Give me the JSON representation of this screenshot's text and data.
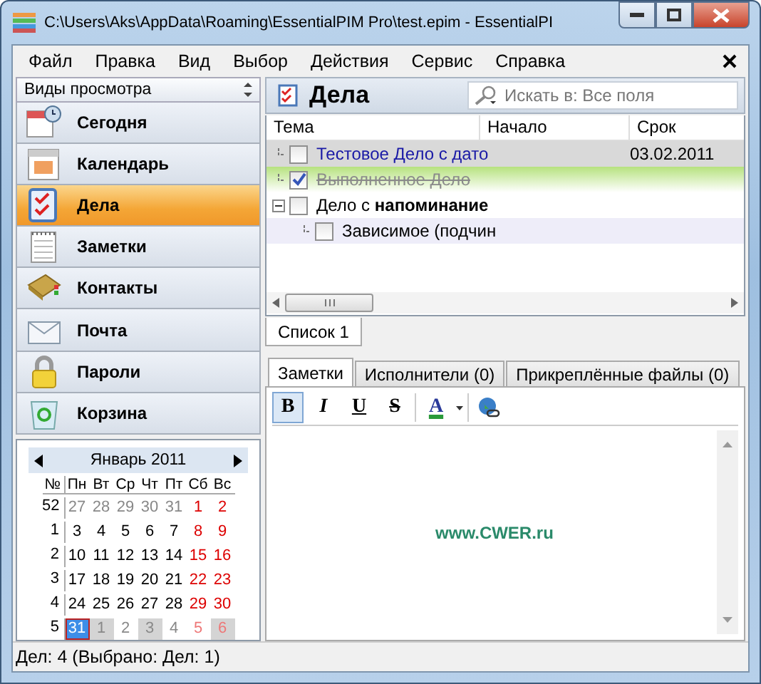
{
  "window": {
    "title": "C:\\Users\\Aks\\AppData\\Roaming\\EssentialPIM Pro\\test.epim - EssentialPI"
  },
  "menu": [
    {
      "label": "Файл"
    },
    {
      "label": "Правка"
    },
    {
      "label": "Вид"
    },
    {
      "label": "Выбор"
    },
    {
      "label": "Действия"
    },
    {
      "label": "Сервис"
    },
    {
      "label": "Справка"
    }
  ],
  "sidebar": {
    "header": "Виды просмотра",
    "items": [
      {
        "label": "Сегодня",
        "kind": "today",
        "selected": false
      },
      {
        "label": "Календарь",
        "kind": "calendar",
        "selected": false
      },
      {
        "label": "Дела",
        "kind": "tasks",
        "selected": true
      },
      {
        "label": "Заметки",
        "kind": "notes",
        "selected": false
      },
      {
        "label": "Контакты",
        "kind": "contacts",
        "selected": false
      },
      {
        "label": "Почта",
        "kind": "mail",
        "selected": false
      },
      {
        "label": "Пароли",
        "kind": "passwords",
        "selected": false
      },
      {
        "label": "Корзина",
        "kind": "trash",
        "selected": false
      }
    ]
  },
  "calendar": {
    "month": "Январь  2011",
    "headers": [
      "№",
      "Пн",
      "Вт",
      "Ср",
      "Чт",
      "Пт",
      "Сб",
      "Вс"
    ],
    "weeks": [
      {
        "num": "52",
        "days": [
          {
            "text": "27",
            "kind": "other",
            "marked": false
          },
          {
            "text": "28",
            "kind": "other",
            "marked": false
          },
          {
            "text": "29",
            "kind": "other",
            "marked": false
          },
          {
            "text": "30",
            "kind": "other",
            "marked": false
          },
          {
            "text": "31",
            "kind": "other",
            "marked": false
          },
          {
            "text": "1",
            "kind": "weekend",
            "marked": false
          },
          {
            "text": "2",
            "kind": "weekend",
            "marked": false
          }
        ]
      },
      {
        "num": "1",
        "days": [
          {
            "text": "3",
            "kind": "normal",
            "marked": false
          },
          {
            "text": "4",
            "kind": "normal",
            "marked": false
          },
          {
            "text": "5",
            "kind": "normal",
            "marked": false
          },
          {
            "text": "6",
            "kind": "normal",
            "marked": false
          },
          {
            "text": "7",
            "kind": "normal",
            "marked": false
          },
          {
            "text": "8",
            "kind": "weekend",
            "marked": false
          },
          {
            "text": "9",
            "kind": "weekend",
            "marked": false
          }
        ]
      },
      {
        "num": "2",
        "days": [
          {
            "text": "10",
            "kind": "normal",
            "marked": false
          },
          {
            "text": "11",
            "kind": "normal",
            "marked": false
          },
          {
            "text": "12",
            "kind": "normal",
            "marked": false
          },
          {
            "text": "13",
            "kind": "normal",
            "marked": false
          },
          {
            "text": "14",
            "kind": "normal",
            "marked": false
          },
          {
            "text": "15",
            "kind": "weekend",
            "marked": false
          },
          {
            "text": "16",
            "kind": "weekend",
            "marked": false
          }
        ]
      },
      {
        "num": "3",
        "days": [
          {
            "text": "17",
            "kind": "normal",
            "marked": false
          },
          {
            "text": "18",
            "kind": "normal",
            "marked": false
          },
          {
            "text": "19",
            "kind": "normal",
            "marked": false
          },
          {
            "text": "20",
            "kind": "normal",
            "marked": false
          },
          {
            "text": "21",
            "kind": "normal",
            "marked": false
          },
          {
            "text": "22",
            "kind": "weekend",
            "marked": false
          },
          {
            "text": "23",
            "kind": "weekend",
            "marked": false
          }
        ]
      },
      {
        "num": "4",
        "days": [
          {
            "text": "24",
            "kind": "normal",
            "marked": false
          },
          {
            "text": "25",
            "kind": "normal",
            "marked": false
          },
          {
            "text": "26",
            "kind": "normal",
            "marked": false
          },
          {
            "text": "27",
            "kind": "normal",
            "marked": false
          },
          {
            "text": "28",
            "kind": "normal",
            "marked": false
          },
          {
            "text": "29",
            "kind": "weekend",
            "marked": false
          },
          {
            "text": "30",
            "kind": "weekend",
            "marked": false
          }
        ]
      },
      {
        "num": "5",
        "days": [
          {
            "text": "31",
            "kind": "today",
            "marked": false
          },
          {
            "text": "1",
            "kind": "other",
            "marked": true
          },
          {
            "text": "2",
            "kind": "other",
            "marked": false
          },
          {
            "text": "3",
            "kind": "other",
            "marked": true
          },
          {
            "text": "4",
            "kind": "other",
            "marked": false
          },
          {
            "text": "5",
            "kind": "other-weekend",
            "marked": false
          },
          {
            "text": "6",
            "kind": "other-weekend",
            "marked": true
          }
        ]
      }
    ]
  },
  "tasks": {
    "title": "Дела",
    "search": {
      "placeholder": "Искать в: Все поля"
    },
    "columns": [
      "Тема",
      "Начало",
      "Срок"
    ],
    "rows": [
      {
        "subject": "Тестовое Дело с дато",
        "due": "03.02.2011",
        "checked": false,
        "selected": true,
        "color": "#1a1aa6"
      },
      {
        "subject": "Выполненное Дело",
        "checked": true,
        "selected": false,
        "color": "#8a8a8a"
      },
      {
        "subject": "Дело с **напоминание**",
        "checked": false,
        "selected": false,
        "color": "#000000",
        "expanded": true,
        "children": [
          {
            "subject": "Зависимое (подчин",
            "checked": false,
            "selected": false,
            "color": "#000000"
          }
        ]
      }
    ]
  },
  "list_tabs": [
    {
      "label": "Список 1",
      "selected": true
    }
  ],
  "detail_tabs": [
    {
      "label": "Заметки",
      "selected": true
    },
    {
      "label": "Исполнители (0)",
      "selected": false
    },
    {
      "label": "Прикреплённые файлы (0)",
      "selected": false
    }
  ],
  "format_toolbar": [
    {
      "kind": "bold",
      "label": "B",
      "on": true
    },
    {
      "kind": "italic",
      "label": "I",
      "on": false
    },
    {
      "kind": "underline",
      "label": "U",
      "on": false
    },
    {
      "kind": "strike",
      "label": "S",
      "on": false
    },
    {
      "kind": "color",
      "label": "A",
      "on": false
    },
    {
      "kind": "link",
      "on": false
    }
  ],
  "notes": {
    "text": "www.CWER.ru"
  },
  "status_bar": "Дел: 4 (Выбрано: Дел: 1)"
}
